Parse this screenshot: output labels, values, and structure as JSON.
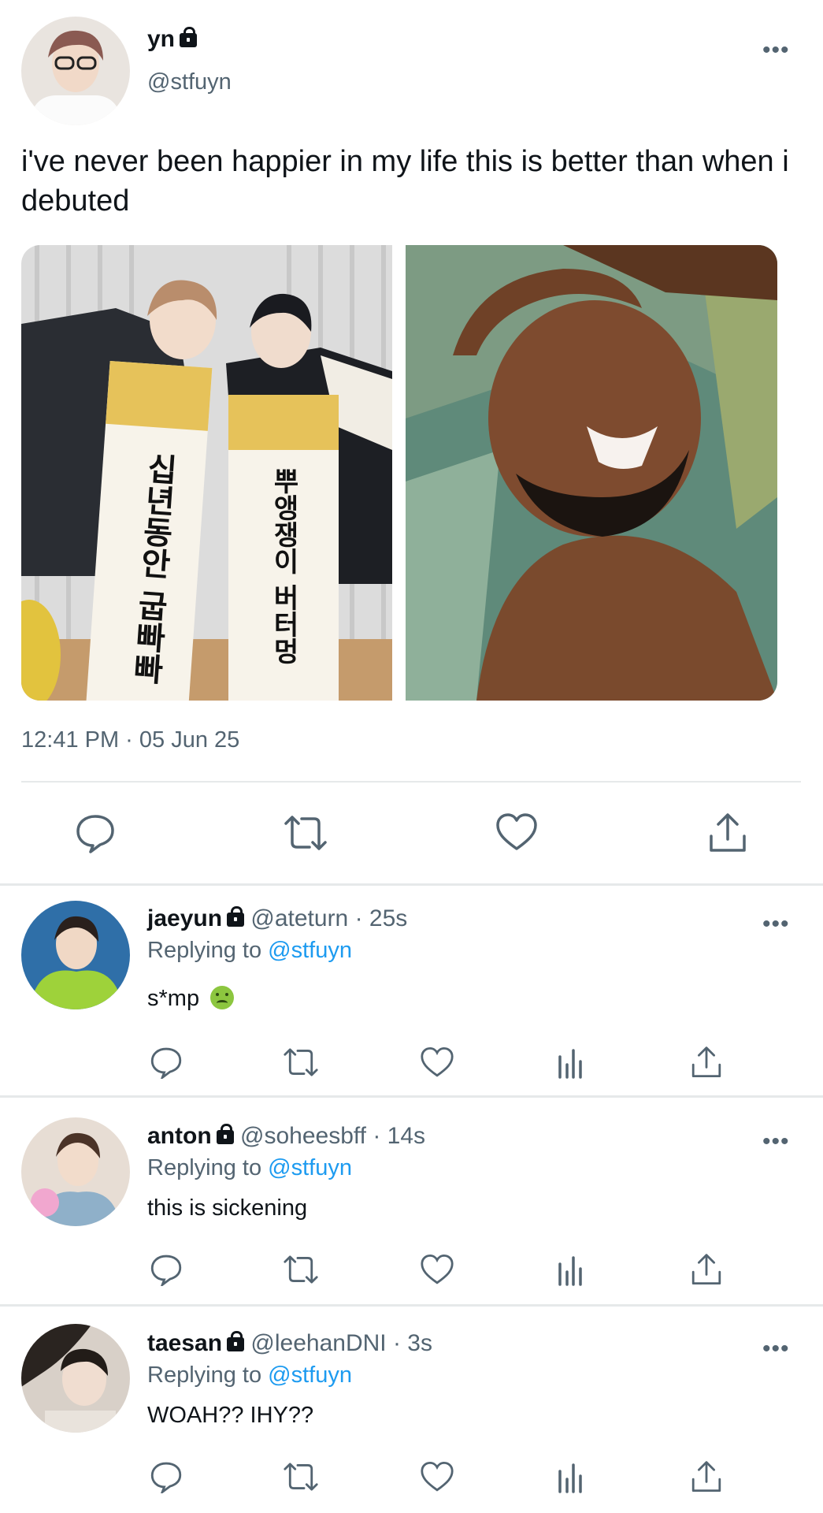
{
  "tweet": {
    "name": "yn",
    "handle": "@stfuyn",
    "text": "i've never been happier in my life this is better than when i debuted",
    "time": "12:41 PM · 05 Jun 25",
    "images": [
      {
        "name": "scroll-photo",
        "scroll_left": "십년동안 굽빠빠",
        "scroll_right": "뿌앵쟁이 버터멍"
      },
      {
        "name": "laughing-man-photo"
      }
    ],
    "actions": [
      "reply-icon",
      "retweet-icon",
      "like-icon",
      "share-icon"
    ]
  },
  "replies": [
    {
      "name": "jaeyun",
      "handle": "@ateturn",
      "time": "· 25s",
      "replying_label": "Replying to",
      "replying_to": "@stfuyn",
      "text": "s*mp",
      "emoji": "nauseated-face-emoji",
      "avatar_colors": [
        "#2f6fa8",
        "#9ed23a"
      ]
    },
    {
      "name": "anton",
      "handle": "@soheesbff",
      "time": "· 14s",
      "replying_label": "Replying to",
      "replying_to": "@stfuyn",
      "text": "this is sickening",
      "avatar_colors": [
        "#d9c8bb",
        "#f1a7cf"
      ]
    },
    {
      "name": "taesan",
      "handle": "@leehanDNI",
      "time": "· 3s",
      "replying_label": "Replying to",
      "replying_to": "@stfuyn",
      "text": "WOAH?? IHY??",
      "avatar_colors": [
        "#cfc6bd",
        "#2a2420"
      ]
    }
  ],
  "colors": {
    "text": "#0f1419",
    "secondary": "#536471",
    "accent": "#1d9bf0",
    "divider": "#e6e9ea"
  }
}
